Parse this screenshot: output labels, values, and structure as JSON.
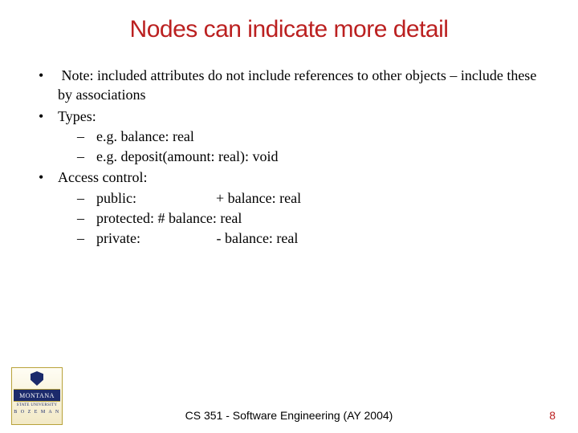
{
  "title": "Nodes can indicate more detail",
  "bullets": [
    {
      "text": " Note: included attributes do not include references to other objects – include these by associations"
    },
    {
      "text": "Types:",
      "sub": [
        "e.g. balance: real",
        "e.g. deposit(amount: real): void"
      ]
    },
    {
      "text": "Access control:",
      "sub": [
        "public:                      + balance: real",
        "protected: # balance: real",
        "private:                     - balance: real"
      ]
    }
  ],
  "logo": {
    "band": "MONTANA",
    "sub1": "STATE UNIVERSITY",
    "sub2": "B O Z E M A N"
  },
  "footer": "CS 351 - Software Engineering (AY 2004)",
  "page": "8"
}
